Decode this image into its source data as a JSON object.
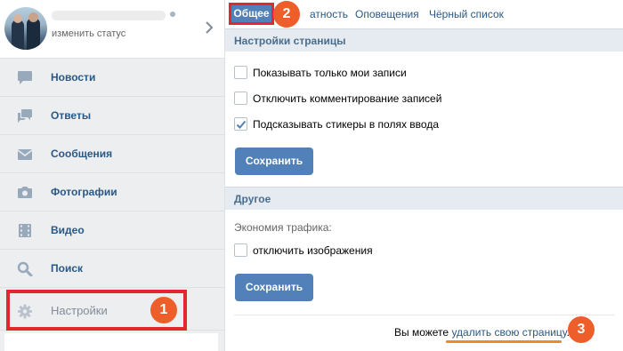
{
  "profile": {
    "status_link": "изменить статус"
  },
  "sidebar": {
    "items": [
      {
        "label": "Новости",
        "icon": "news-icon"
      },
      {
        "label": "Ответы",
        "icon": "replies-icon"
      },
      {
        "label": "Сообщения",
        "icon": "messages-icon"
      },
      {
        "label": "Фотографии",
        "icon": "camera-icon"
      },
      {
        "label": "Видео",
        "icon": "video-icon"
      },
      {
        "label": "Поиск",
        "icon": "search-icon"
      },
      {
        "label": "Настройки",
        "icon": "gear-icon"
      }
    ]
  },
  "tabs": {
    "active": "Общее",
    "partial": "атность",
    "notifications": "Оповещения",
    "blacklist": "Чёрный список"
  },
  "page_settings": {
    "title": "Настройки страницы",
    "options": [
      {
        "label": "Показывать только мои записи",
        "checked": false
      },
      {
        "label": "Отключить комментирование записей",
        "checked": false
      },
      {
        "label": "Подсказывать стикеры в полях ввода",
        "checked": true
      }
    ],
    "save_label": "Сохранить"
  },
  "other": {
    "title": "Другое",
    "traffic_label": "Экономия трафика:",
    "option_label": "отключить изображения",
    "option_checked": false,
    "save_label": "Сохранить"
  },
  "footer": {
    "prefix": "Вы можете ",
    "link": "удалить свою страницу",
    "suffix": "."
  },
  "annotations": {
    "badge1": "1",
    "badge2": "2",
    "badge3": "3"
  },
  "colors": {
    "accent": "#5181b8",
    "highlight_red": "#e5262f",
    "badge_orange": "#ee5e2a",
    "link": "#2a5885"
  }
}
